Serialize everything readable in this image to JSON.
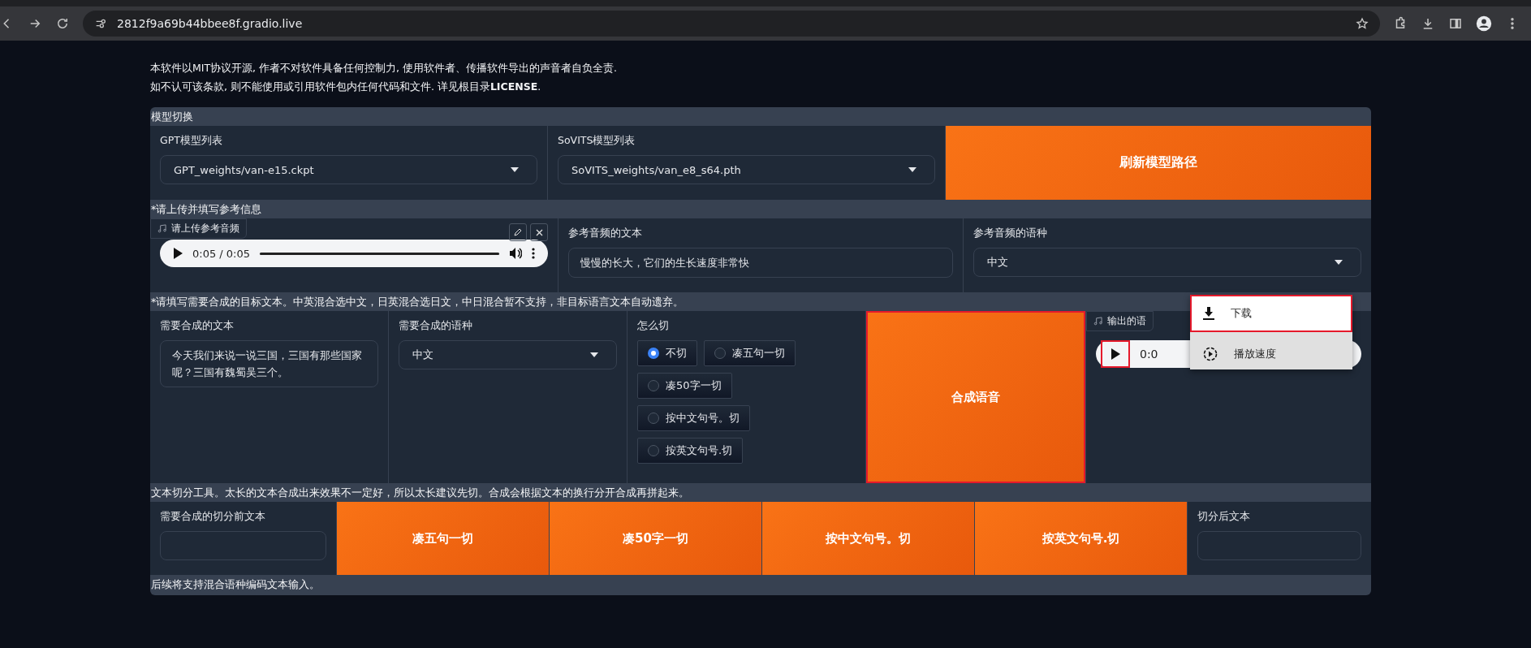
{
  "browser": {
    "url": "2812f9a69b44bbee8f.gradio.live"
  },
  "notice": [
    "本软件以MIT协议开源, 作者不对软件具备任何控制力, 使用软件者、传播软件导出的声音者自负全责.",
    "如不认可该条款, 则不能使用或引用软件包内任何代码和文件. 详见根目录**LICENSE**."
  ],
  "model_section": {
    "title": "模型切换",
    "gpt": {
      "label": "GPT模型列表",
      "value": "GPT_weights/van-e15.ckpt"
    },
    "sovits": {
      "label": "SoVITS模型列表",
      "value": "SoVITS_weights/van_e8_s64.pth"
    },
    "refresh_button": "刷新模型路径"
  },
  "reference_section": {
    "title": "*请上传并填写参考信息",
    "audio": {
      "label": "请上传参考音频",
      "time": "0:05 / 0:05",
      "level": 1
    },
    "text": {
      "label": "参考音频的文本",
      "value": "慢慢的长大，它们的生长速度非常快"
    },
    "language": {
      "label": "参考音频的语种",
      "value": "中文"
    }
  },
  "synthesis_section": {
    "title": "*请填写需要合成的目标文本。中英混合选中文，日英混合选日文，中日混合暂不支持，非目标语言文本自动遗弃。",
    "text": {
      "label": "需要合成的文本",
      "value": "今天我们来说一说三国，三国有那些国家呢？三国有魏蜀吴三个。"
    },
    "language": {
      "label": "需要合成的语种",
      "value": "中文"
    },
    "cut": {
      "label": "怎么切",
      "options": [
        {
          "label": "不切",
          "selected": true
        },
        {
          "label": "凑五句一切",
          "selected": false
        },
        {
          "label": "凑50字一切",
          "selected": false
        },
        {
          "label": "按中文句号。切",
          "selected": false
        },
        {
          "label": "按英文句号.切",
          "selected": false
        }
      ]
    },
    "synth_button": {
      "label": "合成语音",
      "highlighted": true
    },
    "output": {
      "label": "输出的语",
      "time": "0:0",
      "play_highlighted": true
    }
  },
  "context_menu": [
    {
      "kind": "download",
      "label": "下载",
      "hovered": false,
      "highlighted": true
    },
    {
      "kind": "speed",
      "label": "播放速度",
      "hovered": true,
      "highlighted": false
    }
  ],
  "split_section": {
    "title": "文本切分工具。太长的文本合成出来效果不一定好，所以太长建议先切。合成会根据文本的换行分开合成再拼起来。",
    "input_label": "需要合成的切分前文本",
    "buttons": [
      "凑五句一切",
      "凑50字一切",
      "按中文句号。切",
      "按英文句号.切"
    ],
    "output_label": "切分后文本"
  },
  "footer_note": "后续将支持混合语种编码文本输入。"
}
